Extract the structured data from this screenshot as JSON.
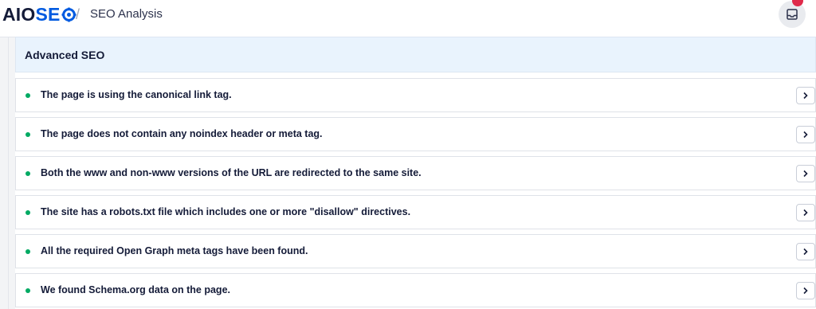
{
  "brand": {
    "logo_aio": "AIO",
    "logo_seo": "SE"
  },
  "breadcrumb": {
    "separator": "/",
    "page": "SEO Analysis"
  },
  "header_actions": {
    "inbox_icon": "inbox-tray-icon",
    "has_notification": true,
    "badge_color": "#df2a4a"
  },
  "section": {
    "title": "Advanced SEO",
    "status_color": "#00aa63",
    "items": [
      {
        "label": "The page is using the canonical link tag.",
        "status": "passed"
      },
      {
        "label": "The page does not contain any noindex header or meta tag.",
        "status": "passed"
      },
      {
        "label": "Both the www and non-www versions of the URL are redirected to the same site.",
        "status": "passed"
      },
      {
        "label": "The site has a robots.txt file which includes one or more \"disallow\" directives.",
        "status": "passed"
      },
      {
        "label": "All the required Open Graph meta tags have been found.",
        "status": "passed"
      },
      {
        "label": "We found Schema.org data on the page.",
        "status": "passed"
      }
    ]
  },
  "colors": {
    "brand_dark": "#141b38",
    "brand_blue": "#005ae0",
    "header_bg": "#e9f3fd"
  }
}
